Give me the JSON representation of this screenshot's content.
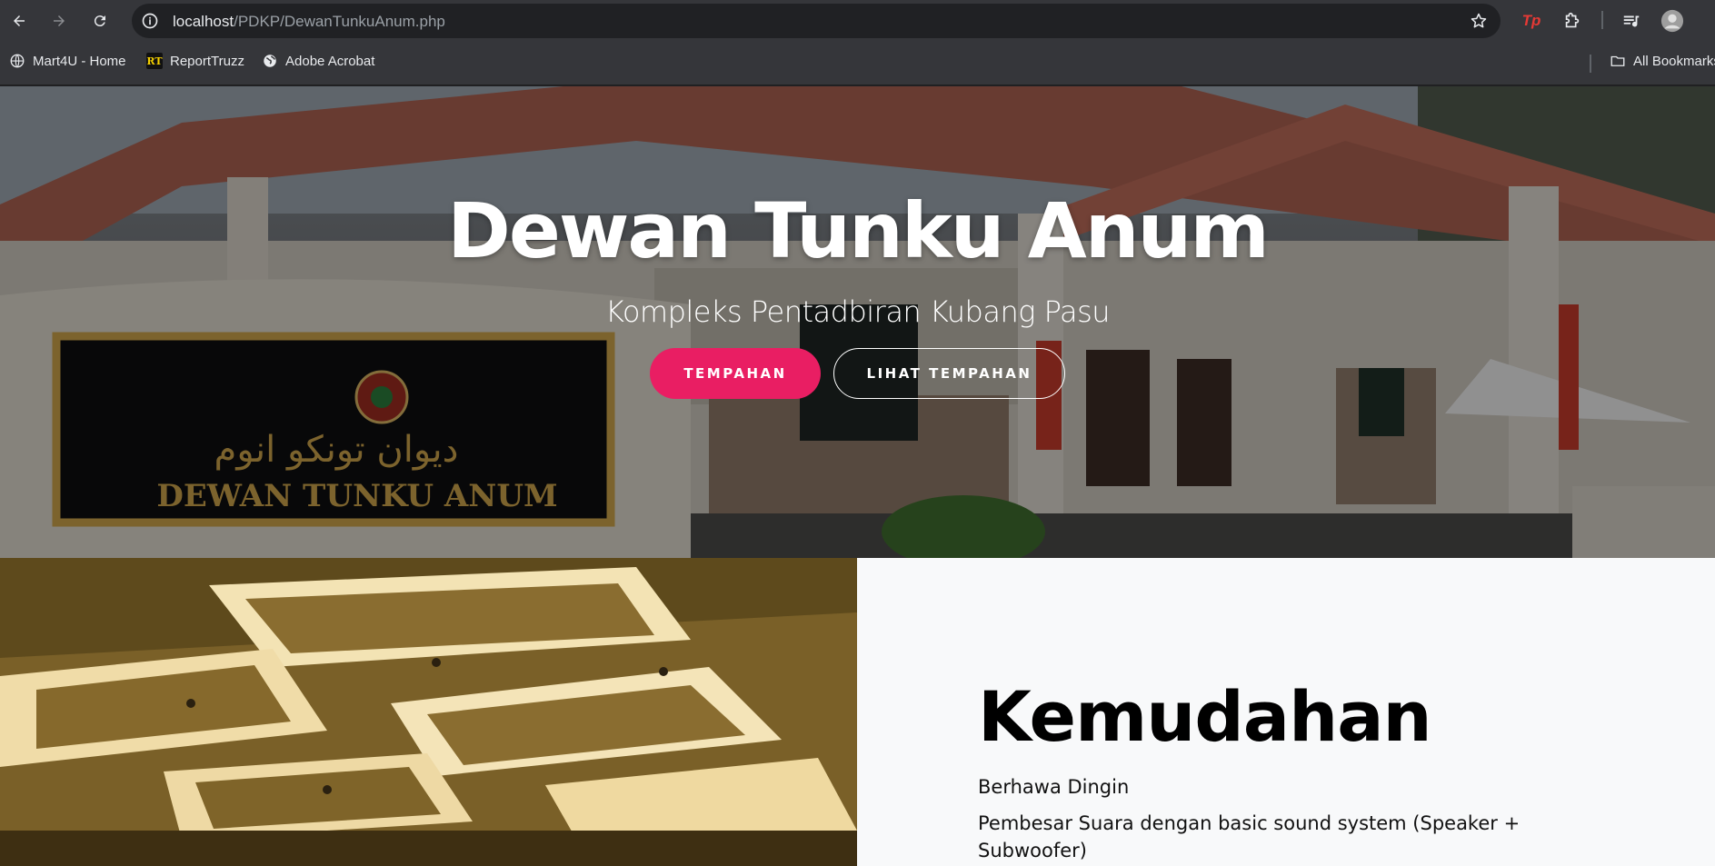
{
  "browser": {
    "url_host": "localhost",
    "url_path": "/PDKP/DewanTunkuAnum.php",
    "icons": {
      "back": "arrow-left-icon",
      "forward": "arrow-right-icon",
      "reload": "reload-icon",
      "site_info": "info-icon",
      "bookmark_star": "star-icon",
      "extensions": "puzzle-icon",
      "media": "media-queue-icon",
      "profile": "avatar-icon"
    },
    "bookmarks": [
      {
        "label": "Mart4U - Home",
        "icon": "globe-icon"
      },
      {
        "label": "ReportTruzz",
        "icon": "rt-logo-icon",
        "icon_text": "RT"
      },
      {
        "label": "Adobe Acrobat",
        "icon": "globe-icon"
      }
    ],
    "all_bookmarks": {
      "label": "All Bookmarks",
      "icon": "folder-icon"
    },
    "ext_logo_text": "Tp"
  },
  "hero": {
    "title": "Dewan Tunku Anum",
    "subtitle": "Kompleks Pentadbiran Kubang Pasu",
    "primary_button": "TEMPAHAN",
    "secondary_button": "LIHAT TEMPAHAN",
    "sign_text_latin": "DEWAN TUNKU ANUM",
    "sign_text_jawi": "ديوان تونكو انوم"
  },
  "facilities": {
    "title": "Kemudahan",
    "items": [
      "Berhawa Dingin",
      "Pembesar Suara dengan basic sound system (Speaker + Subwoofer)"
    ]
  },
  "colors": {
    "primary_button": "#e91e63",
    "chrome_bg": "#35363a",
    "omnibox_bg": "#202124"
  }
}
